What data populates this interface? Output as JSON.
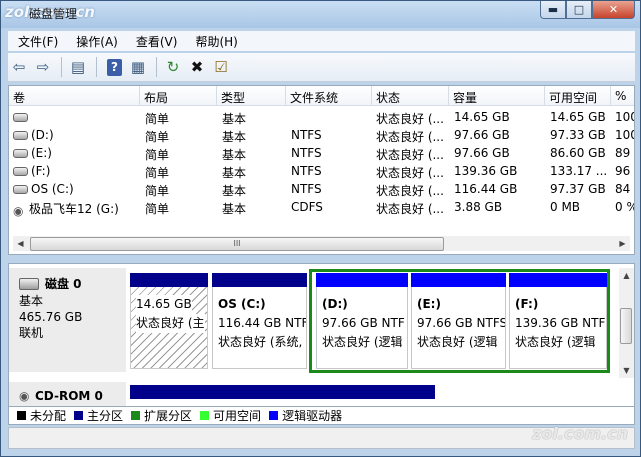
{
  "window": {
    "title": "磁盘管理",
    "watermark_logo": "zol.com.cn",
    "min_icon": "minimize-icon",
    "max_icon": "maximize-icon",
    "close_icon": "close-icon"
  },
  "menu": [
    "文件(F)",
    "操作(A)",
    "查看(V)",
    "帮助(H)"
  ],
  "toolbar": [
    "back-arrow-icon",
    "forward-arrow-icon",
    "list-view-icon",
    "help-icon",
    "properties-icon",
    "refresh-icon",
    "delete-icon",
    "checklist-icon"
  ],
  "volume_list": {
    "columns": [
      "卷",
      "布局",
      "类型",
      "文件系统",
      "状态",
      "容量",
      "可用空间",
      "%"
    ],
    "rows": [
      {
        "volume": "",
        "layout": "简单",
        "type": "基本",
        "fs": "",
        "status": "状态良好 (...",
        "capacity": "14.65 GB",
        "free": "14.65 GB",
        "pct": "100"
      },
      {
        "volume": "(D:)",
        "layout": "简单",
        "type": "基本",
        "fs": "NTFS",
        "status": "状态良好 (...",
        "capacity": "97.66 GB",
        "free": "97.33 GB",
        "pct": "100"
      },
      {
        "volume": "(E:)",
        "layout": "简单",
        "type": "基本",
        "fs": "NTFS",
        "status": "状态良好 (...",
        "capacity": "97.66 GB",
        "free": "86.60 GB",
        "pct": "89"
      },
      {
        "volume": "(F:)",
        "layout": "简单",
        "type": "基本",
        "fs": "NTFS",
        "status": "状态良好 (...",
        "capacity": "139.36 GB",
        "free": "133.17 ...",
        "pct": "96"
      },
      {
        "volume": "OS (C:)",
        "layout": "简单",
        "type": "基本",
        "fs": "NTFS",
        "status": "状态良好 (...",
        "capacity": "116.44 GB",
        "free": "97.37 GB",
        "pct": "84"
      },
      {
        "volume": "极品飞车12 (G:)",
        "layout": "简单",
        "type": "基本",
        "fs": "CDFS",
        "status": "状态良好 (...",
        "capacity": "3.88 GB",
        "free": "0 MB",
        "pct": "0 %"
      }
    ],
    "hscroll_thumb": "III"
  },
  "disk0": {
    "name": "磁盘 0",
    "type": "基本",
    "size": "465.76 GB",
    "state": "联机",
    "partitions": [
      {
        "title": "",
        "size": "14.65 GB",
        "status": "状态良好 (主"
      },
      {
        "title": "OS  (C:)",
        "size": "116.44 GB NTF",
        "status": "状态良好 (系统,"
      },
      {
        "title": "(D:)",
        "size": "97.66 GB NTF",
        "status": "状态良好 (逻辑"
      },
      {
        "title": "(E:)",
        "size": "97.66 GB NTFS",
        "status": "状态良好 (逻辑"
      },
      {
        "title": "(F:)",
        "size": "139.36 GB NTF",
        "status": "状态良好 (逻辑"
      }
    ]
  },
  "cdrom": {
    "name": "CD-ROM 0"
  },
  "legend": [
    {
      "label": "未分配",
      "color": "#000000"
    },
    {
      "label": "主分区",
      "color": "#00008b"
    },
    {
      "label": "扩展分区",
      "color": "#1b8a1b"
    },
    {
      "label": "可用空间",
      "color": "#33ff33"
    },
    {
      "label": "逻辑驱动器",
      "color": "#0000ff"
    }
  ],
  "footer_watermark": "zol.com.cn"
}
